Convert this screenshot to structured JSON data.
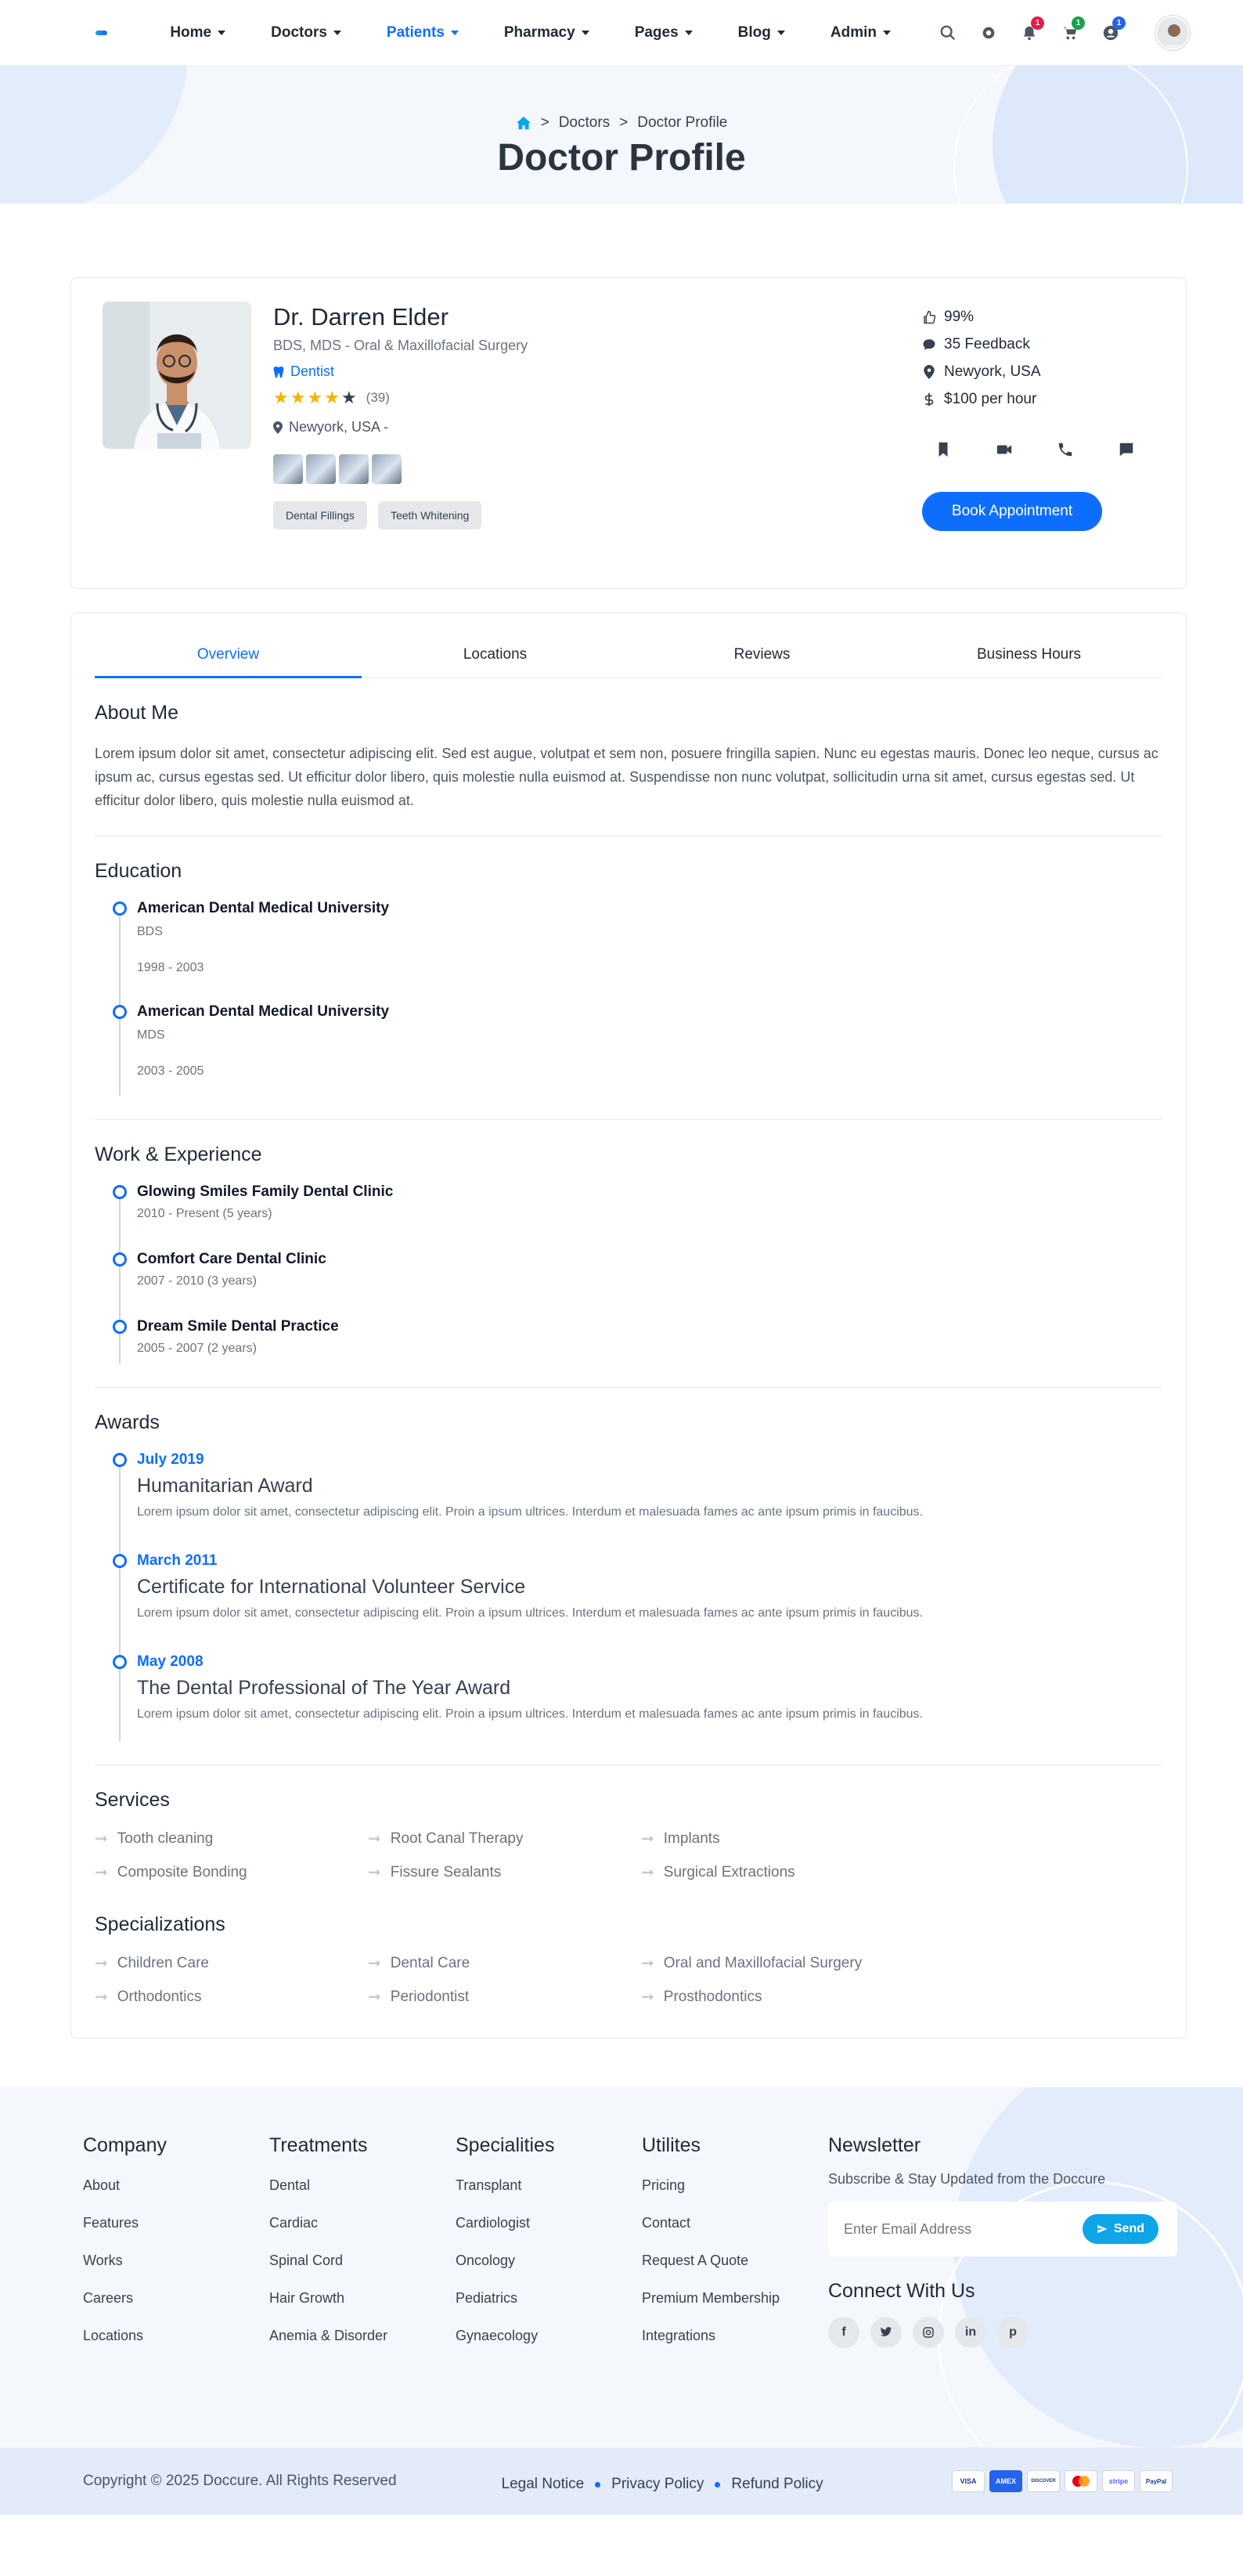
{
  "nav": {
    "items": [
      {
        "label": "Home",
        "active": false
      },
      {
        "label": "Doctors",
        "active": false
      },
      {
        "label": "Patients",
        "active": true
      },
      {
        "label": "Pharmacy",
        "active": false
      },
      {
        "label": "Pages",
        "active": false
      },
      {
        "label": "Blog",
        "active": false
      },
      {
        "label": "Admin",
        "active": false
      }
    ],
    "badges": {
      "notifications": "1",
      "cart": "1",
      "messages": "1"
    }
  },
  "breadcrumb": {
    "items": [
      "Doctors",
      "Doctor Profile"
    ],
    "separator": ">"
  },
  "page_title": "Doctor Profile",
  "doctor": {
    "name": "Dr. Darren Elder",
    "degree": "BDS, MDS - Oral & Maxillofacial Surgery",
    "speciality": "Dentist",
    "rating_count": "(39)",
    "rating": 4,
    "location": "Newyork, USA -",
    "tags": [
      "Dental Fillings",
      "Teeth Whitening"
    ],
    "stats": {
      "likes": "99%",
      "feedback": "35 Feedback",
      "location": "Newyork, USA",
      "price": "$100 per hour"
    },
    "book_label": "Book Appointment"
  },
  "tabs": [
    "Overview",
    "Locations",
    "Reviews",
    "Business Hours"
  ],
  "about": {
    "title": "About Me",
    "text": "Lorem ipsum dolor sit amet, consectetur adipiscing elit. Sed est augue, volutpat et sem non, posuere fringilla sapien. Nunc eu egestas mauris. Donec leo neque, cursus ac ipsum ac, cursus egestas sed. Ut efficitur dolor libero, quis molestie nulla euismod at. Suspendisse non nunc volutpat, sollicitudin urna sit amet, cursus egestas sed. Ut efficitur dolor libero, quis molestie nulla euismod at."
  },
  "education": {
    "title": "Education",
    "items": [
      {
        "school": "American Dental Medical University",
        "degree": "BDS",
        "years": "1998 - 2003"
      },
      {
        "school": "American Dental Medical University",
        "degree": "MDS",
        "years": "2003 - 2005"
      }
    ]
  },
  "experience": {
    "title": "Work & Experience",
    "items": [
      {
        "place": "Glowing Smiles Family Dental Clinic",
        "period": "2010 - Present (5 years)"
      },
      {
        "place": "Comfort Care Dental Clinic",
        "period": "2007 - 2010 (3 years)"
      },
      {
        "place": "Dream Smile Dental Practice",
        "period": "2005 - 2007 (2 years)"
      }
    ]
  },
  "awards": {
    "title": "Awards",
    "items": [
      {
        "date": "July 2019",
        "title": "Humanitarian Award",
        "text": "Lorem ipsum dolor sit amet, consectetur adipiscing elit. Proin a ipsum ultrices. Interdum et malesuada fames ac ante ipsum primis in faucibus."
      },
      {
        "date": "March 2011",
        "title": "Certificate for International Volunteer Service",
        "text": "Lorem ipsum dolor sit amet, consectetur adipiscing elit. Proin a ipsum ultrices. Interdum et malesuada fames ac ante ipsum primis in faucibus."
      },
      {
        "date": "May 2008",
        "title": "The Dental Professional of The Year Award",
        "text": "Lorem ipsum dolor sit amet, consectetur adipiscing elit. Proin a ipsum ultrices. Interdum et malesuada fames ac ante ipsum primis in faucibus."
      }
    ]
  },
  "services": {
    "title": "Services",
    "items": [
      "Tooth cleaning",
      "Root Canal Therapy",
      "Implants",
      "Composite Bonding",
      "Fissure Sealants",
      "Surgical Extractions"
    ]
  },
  "specializations": {
    "title": "Specializations",
    "items": [
      "Children Care",
      "Dental Care",
      "Oral and Maxillofacial Surgery",
      "Orthodontics",
      "Periodontist",
      "Prosthodontics"
    ]
  },
  "footer": {
    "columns": [
      {
        "title": "Company",
        "links": [
          "About",
          "Features",
          "Works",
          "Careers",
          "Locations"
        ]
      },
      {
        "title": "Treatments",
        "links": [
          "Dental",
          "Cardiac",
          "Spinal Cord",
          "Hair Growth",
          "Anemia & Disorder"
        ]
      },
      {
        "title": "Specialities",
        "links": [
          "Transplant",
          "Cardiologist",
          "Oncology",
          "Pediatrics",
          "Gynaecology"
        ]
      },
      {
        "title": "Utilites",
        "links": [
          "Pricing",
          "Contact",
          "Request A Quote",
          "Premium Membership",
          "Integrations"
        ]
      }
    ],
    "newsletter": {
      "title": "Newsletter",
      "text": "Subscribe & Stay Updated from the Doccure",
      "placeholder": "Enter Email Address",
      "send_label": "Send"
    },
    "connect_title": "Connect With Us",
    "copyright": "Copyright © 2025 Doccure. All Rights Reserved",
    "policies": [
      "Legal Notice",
      "Privacy Policy",
      "Refund Policy"
    ],
    "payments": [
      "VISA",
      "AMEX",
      "DISCOVER",
      "MC",
      "stripe",
      "PayPal"
    ]
  },
  "colors": {
    "primary": "#0d6efd",
    "star": "#f5b400",
    "badge_red": "#e11d48",
    "badge_green": "#16a34a"
  }
}
